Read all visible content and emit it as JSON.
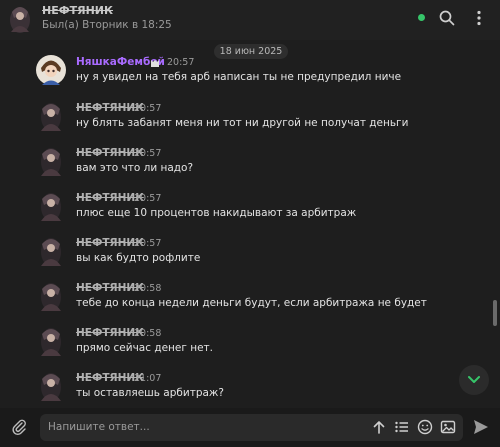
{
  "header": {
    "title": "НЕФТЯНИК",
    "status": "Был(а) Вторник в 18:25"
  },
  "date_separator": "18 июн 2025",
  "messages": [
    {
      "sender": "НяшкаФембой",
      "time": "20:57",
      "text": "ну я увидел на тебя арб написан ты не предупредил ниче",
      "sender_color": "#a96bff"
    },
    {
      "sender": "НЕФТЯНИК",
      "time": "20:57",
      "text": "ну блять забанят меня ни тот ни другой не получат деньги"
    },
    {
      "sender": "НЕФТЯНИК",
      "time": "20:57",
      "text": "вам это что ли надо?"
    },
    {
      "sender": "НЕФТЯНИК",
      "time": "20:57",
      "text": "плюс еще 10 процентов накидывают за арбитраж"
    },
    {
      "sender": "НЕФТЯНИК",
      "time": "20:57",
      "text": "вы как будто рофлите"
    },
    {
      "sender": "НЕФТЯНИК",
      "time": "20:58",
      "text": "тебе до конца недели деньги будут, если арбитража не будет"
    },
    {
      "sender": "НЕФТЯНИК",
      "time": "20:58",
      "text": "прямо сейчас денег нет."
    },
    {
      "sender": "НЕФТЯНИК",
      "time": "21:07",
      "text": "ты оставляешь арбитраж?"
    }
  ],
  "composer": {
    "placeholder": "Напишите ответ..."
  },
  "icons": {
    "header": [
      "search-icon",
      "more-vertical-icon"
    ],
    "composer": [
      "attach-icon",
      "format-up-icon",
      "list-icon",
      "emoji-icon",
      "image-icon",
      "send-icon"
    ]
  },
  "colors": {
    "background": "#1e1e1e",
    "accent_online": "#36c56a",
    "sender_accent": "#a96bff",
    "scroll_down_arrow": "#36c56a"
  }
}
